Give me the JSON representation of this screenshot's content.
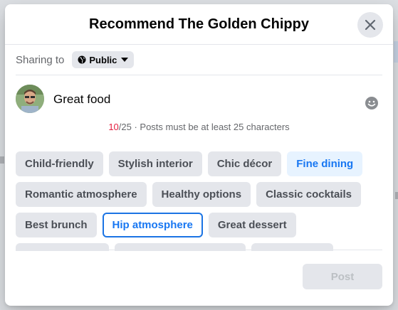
{
  "dialog": {
    "title": "Recommend The Golden Chippy"
  },
  "sharing": {
    "label": "Sharing to",
    "privacy": "Public"
  },
  "post": {
    "text": "Great food",
    "counter_current": "10",
    "counter_rest": "/25 · Posts must be at least 25 characters"
  },
  "chips": {
    "rows": [
      [
        {
          "label": "Child-friendly",
          "state": "default"
        },
        {
          "label": "Stylish interior",
          "state": "default"
        },
        {
          "label": "Chic décor",
          "state": "default"
        },
        {
          "label": "Fine dining",
          "state": "selected-fill"
        }
      ],
      [
        {
          "label": "Romantic atmosphere",
          "state": "default"
        },
        {
          "label": "Healthy options",
          "state": "default"
        },
        {
          "label": "Classic cocktails",
          "state": "default"
        }
      ],
      [
        {
          "label": "Best brunch",
          "state": "default"
        },
        {
          "label": "Hip atmosphere",
          "state": "selected-border"
        },
        {
          "label": "Great dessert",
          "state": "default"
        }
      ]
    ]
  },
  "footer": {
    "post_label": "Post"
  },
  "colors": {
    "accent": "#1877f2",
    "counter_warning": "#e41e3f",
    "chip_bg": "#e4e6eb",
    "selected_bg": "#e7f3ff"
  },
  "icons": {
    "close": "close-icon",
    "globe": "globe-icon",
    "caret": "caret-down-icon",
    "emoji": "emoji-icon"
  }
}
